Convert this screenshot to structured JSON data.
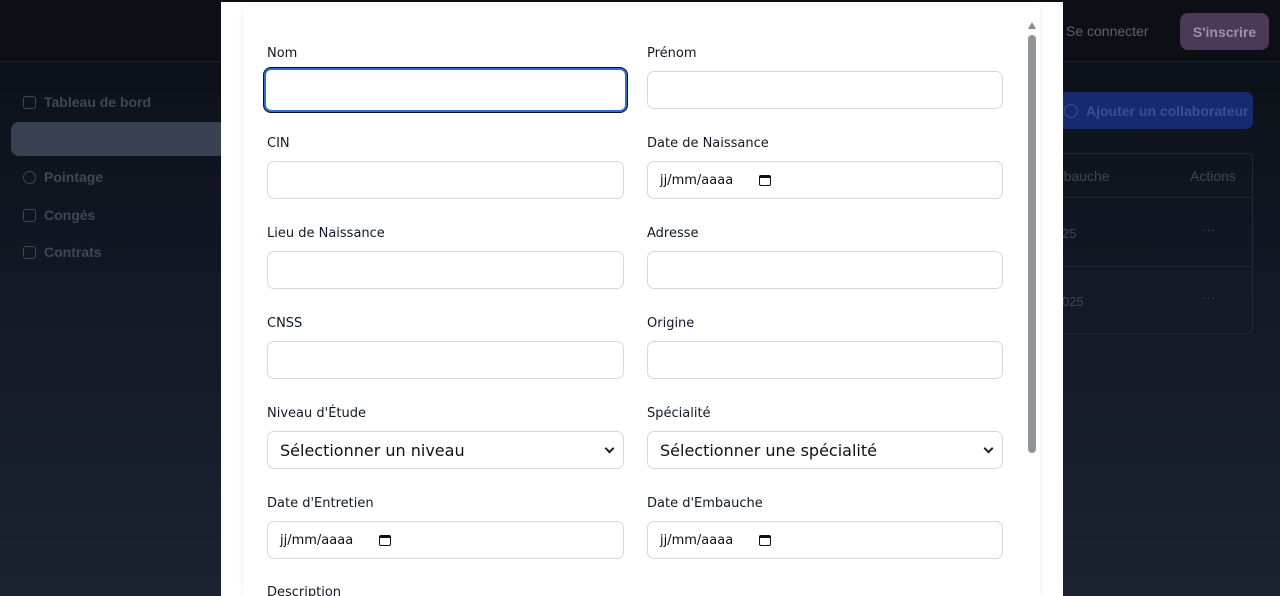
{
  "topbar": {
    "login_label": "Se connecter",
    "signup_label": "S'inscrire"
  },
  "sidebar": {
    "items": [
      {
        "label": "Tableau de bord"
      },
      {
        "label": "Pointage"
      },
      {
        "label": "Congés"
      },
      {
        "label": "Contrats"
      }
    ]
  },
  "background_page": {
    "add_button_label": "Ajouter un collaborateur",
    "table_headers": [
      "mbauche",
      "Actions"
    ],
    "rows": [
      {
        "date": "25",
        "actions": "···"
      },
      {
        "date": "025",
        "actions": "···"
      }
    ]
  },
  "form": {
    "nom": {
      "label": "Nom",
      "value": ""
    },
    "prenom": {
      "label": "Prénom",
      "value": ""
    },
    "cin": {
      "label": "CIN",
      "value": ""
    },
    "date_naissance": {
      "label": "Date de Naissance",
      "placeholder": "jj/mm/aaaa"
    },
    "lieu_naissance": {
      "label": "Lieu de Naissance",
      "value": ""
    },
    "adresse": {
      "label": "Adresse",
      "value": ""
    },
    "cnss": {
      "label": "CNSS",
      "value": ""
    },
    "origine": {
      "label": "Origine",
      "value": ""
    },
    "niveau_etude": {
      "label": "Niveau d'Étude",
      "selected": "Sélectionner un niveau"
    },
    "specialite": {
      "label": "Spécialité",
      "selected": "Sélectionner une spécialité"
    },
    "date_entretien": {
      "label": "Date d'Entretien",
      "placeholder": "jj/mm/aaaa"
    },
    "date_embauche": {
      "label": "Date d'Embauche",
      "placeholder": "jj/mm/aaaa"
    },
    "description": {
      "label": "Description"
    }
  },
  "colors": {
    "focus_ring": "#2f6ad8",
    "field_border": "#d5d9df",
    "modal_bg": "#ffffff",
    "backdrop": "#111827"
  }
}
